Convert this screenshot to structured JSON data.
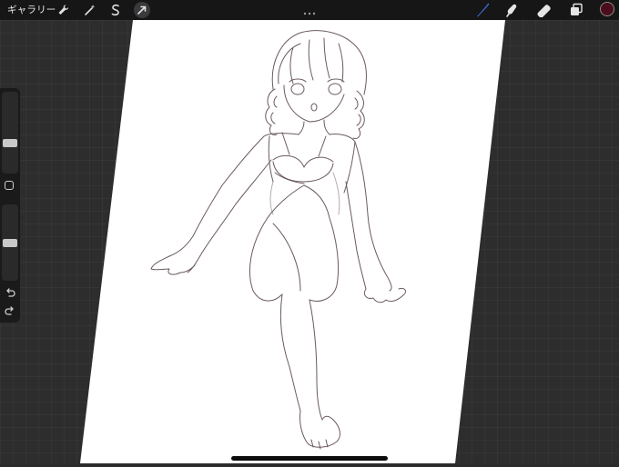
{
  "topbar": {
    "gallery_label": "ギャラリー",
    "left_tools": [
      "wrench-icon",
      "magic-wand-icon",
      "selection-s-icon",
      "transform-arrow-icon"
    ],
    "right_tools": [
      "brush-icon",
      "smudge-icon",
      "eraser-icon",
      "layers-icon"
    ],
    "active_tool": "brush-icon",
    "accent_color": "#3b6fd6",
    "current_color": "#4a0d1c"
  },
  "sidebar": {
    "brush_size_level": 0.5,
    "opacity_level": 0.5,
    "icons": [
      "modify-square-icon",
      "undo-icon",
      "redo-icon"
    ]
  },
  "canvas": {
    "background": "#ffffff",
    "line_color": "#6b5a60"
  }
}
